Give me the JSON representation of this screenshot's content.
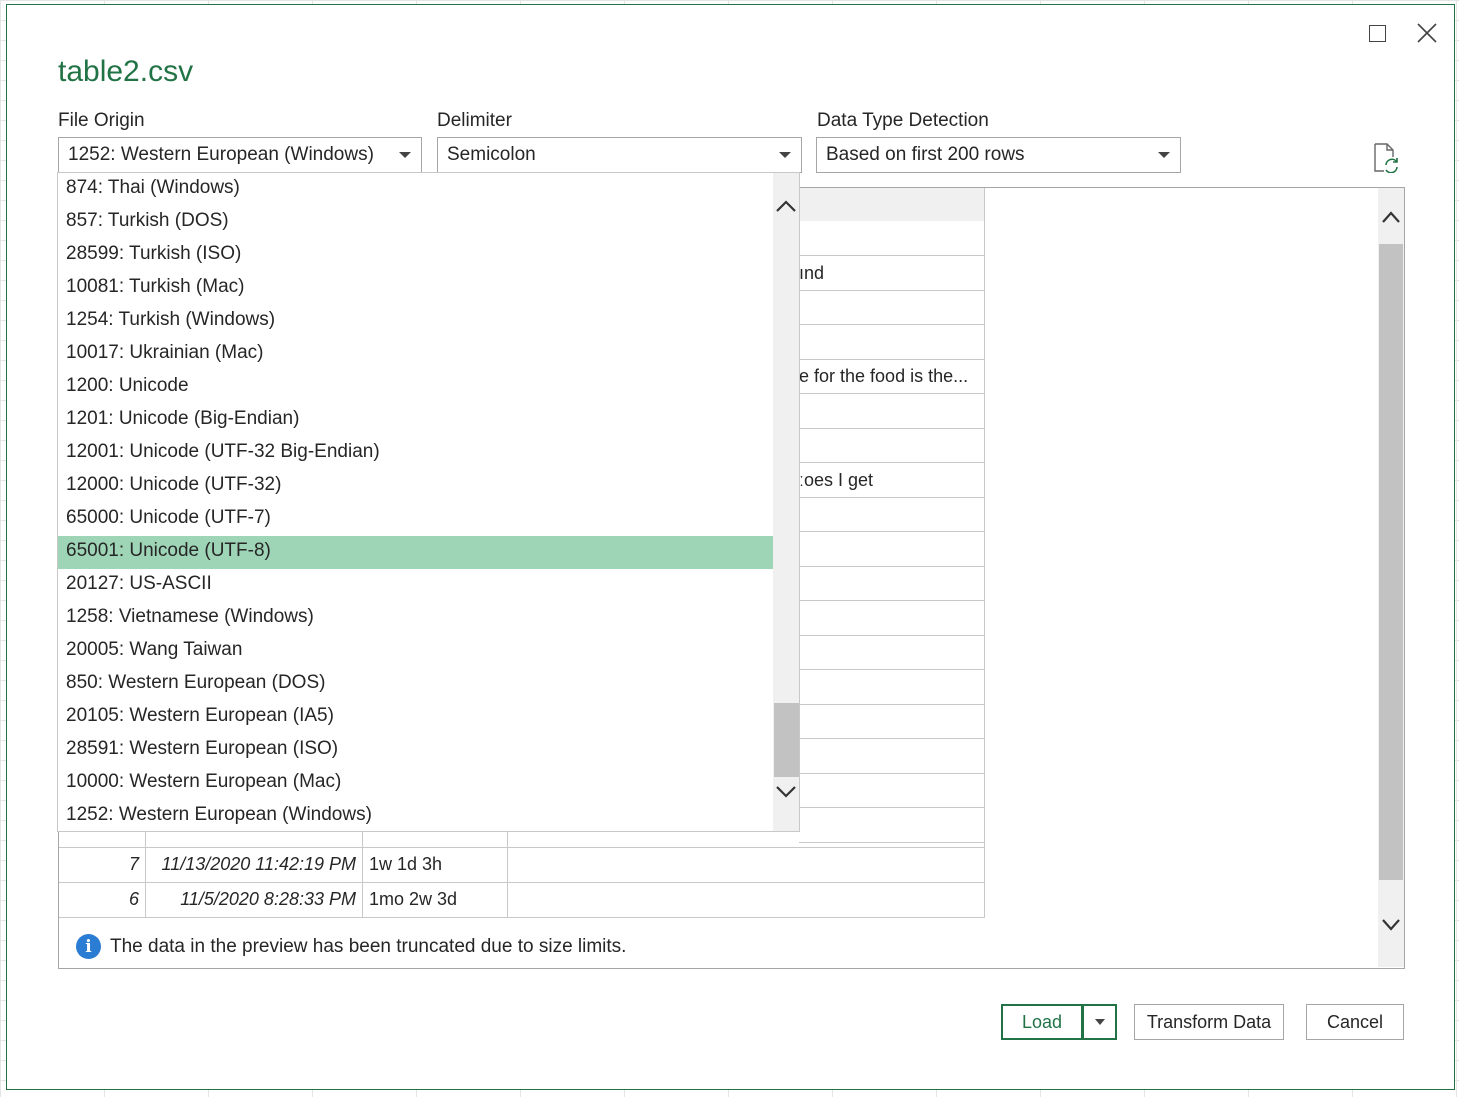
{
  "dialog": {
    "title": "table2.csv",
    "window_controls": {
      "maximize_icon": "maximize-icon",
      "close_icon": "close-icon"
    }
  },
  "file_origin": {
    "label": "File Origin",
    "value": "1252: Western European (Windows)"
  },
  "delimiter": {
    "label": "Delimiter",
    "value": "Semicolon"
  },
  "detection": {
    "label": "Data Type Detection",
    "value": "Based on first 200 rows"
  },
  "refresh_icon": "refresh-file-icon",
  "dropdown": {
    "items": [
      "874: Thai (Windows)",
      "857: Turkish (DOS)",
      "28599: Turkish (ISO)",
      "10081: Turkish (Mac)",
      "1254: Turkish (Windows)",
      "10017: Ukrainian (Mac)",
      "1200: Unicode",
      "1201: Unicode (Big-Endian)",
      "12001: Unicode (UTF-32 Big-Endian)",
      "12000: Unicode (UTF-32)",
      "65000: Unicode (UTF-7)",
      "65001: Unicode (UTF-8)",
      "20127: US-ASCII",
      "1258: Vietnamese (Windows)",
      "20005: Wang Taiwan",
      "850: Western European (DOS)",
      "20105: Western European (IA5)",
      "28591: Western European (ISO)",
      "10000: Western European (Mac)",
      "1252: Western European (Windows)"
    ],
    "selected_index": 11
  },
  "preview": {
    "partial_cells": [
      {
        "row": 2,
        "text": "ınd"
      },
      {
        "row": 5,
        "text": "e for the food is the..."
      },
      {
        "row": 8,
        "text": "ːoes I get"
      }
    ],
    "visible_rows": [
      {
        "id": "7",
        "date": "11/13/2020 11:42:19 PM",
        "age": "1w 1d 3h",
        "text": ""
      },
      {
        "id": "6",
        "date": "11/5/2020 8:28:33 PM",
        "age": "1mo 2w 3d",
        "text": ""
      }
    ],
    "info_text": "The data in the preview has been truncated due to size limits."
  },
  "buttons": {
    "load": "Load",
    "transform": "Transform Data",
    "cancel": "Cancel"
  },
  "colors": {
    "accent": "#217346",
    "selected_item": "#9fd5b7",
    "info": "#2b7cd3"
  }
}
